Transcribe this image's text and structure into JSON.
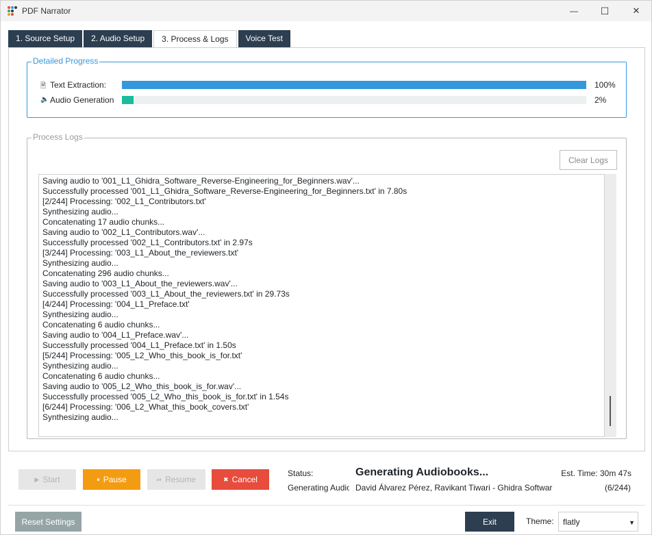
{
  "window": {
    "title": "PDF Narrator",
    "controls": {
      "minimize": "—",
      "maximize": "☐",
      "close": "✕"
    }
  },
  "tabs": [
    {
      "label": "1. Source Setup",
      "active": false
    },
    {
      "label": "2. Audio Setup",
      "active": false
    },
    {
      "label": "3. Process & Logs",
      "active": true
    },
    {
      "label": "Voice Test",
      "active": false
    }
  ],
  "progress": {
    "frame_title": "Detailed Progress",
    "rows": [
      {
        "icon": "document-icon",
        "label": "Text Extraction:",
        "percent_text": "100%",
        "value": 1.0,
        "color": "#3498db"
      },
      {
        "icon": "speaker-icon",
        "label": "Audio Generation",
        "percent_text": "2%",
        "value": 0.025,
        "color": "#1abc9c"
      }
    ]
  },
  "logs": {
    "frame_title": "Process Logs",
    "clear_label": "Clear Logs",
    "lines": [
      "Saving audio to '001_L1_Ghidra_Software_Reverse-Engineering_for_Beginners.wav'...",
      "Successfully processed '001_L1_Ghidra_Software_Reverse-Engineering_for_Beginners.txt' in 7.80s",
      "[2/244] Processing: '002_L1_Contributors.txt'",
      "Synthesizing audio...",
      "Concatenating 17 audio chunks...",
      "Saving audio to '002_L1_Contributors.wav'...",
      "Successfully processed '002_L1_Contributors.txt' in 2.97s",
      "[3/244] Processing: '003_L1_About_the_reviewers.txt'",
      "Synthesizing audio...",
      "Concatenating 296 audio chunks...",
      "Saving audio to '003_L1_About_the_reviewers.wav'...",
      "Successfully processed '003_L1_About_the_reviewers.txt' in 29.73s",
      "[4/244] Processing: '004_L1_Preface.txt'",
      "Synthesizing audio...",
      "Concatenating 6 audio chunks...",
      "Saving audio to '004_L1_Preface.wav'...",
      "Successfully processed '004_L1_Preface.txt' in 1.50s",
      "[5/244] Processing: '005_L2_Who_this_book_is_for.txt'",
      "Synthesizing audio...",
      "Concatenating 6 audio chunks...",
      "Saving audio to '005_L2_Who_this_book_is_for.wav'...",
      "Successfully processed '005_L2_Who_this_book_is_for.txt' in 1.54s",
      "[6/244] Processing: '006_L2_What_this_book_covers.txt'",
      "Synthesizing audio..."
    ]
  },
  "controls": {
    "start": {
      "icon": "play-icon",
      "glyph": "▶",
      "label": "Start",
      "enabled": false
    },
    "pause": {
      "icon": "pause-icon",
      "glyph": "⏸",
      "label": "Pause",
      "enabled": true,
      "color": "#f39c12"
    },
    "resume": {
      "icon": "resume-icon",
      "glyph": "⏯",
      "label": "Resume",
      "enabled": false
    },
    "cancel": {
      "icon": "cancel-icon",
      "glyph": "✖",
      "label": "Cancel",
      "enabled": true,
      "color": "#e74c3c"
    }
  },
  "status": {
    "label": "Status:",
    "title": "Generating Audiobooks...",
    "est_time": "Est. Time: 30m 47s",
    "sub": "Generating Audio",
    "book": "David Álvarez Pérez, Ravikant Tiwari - Ghidra Software R",
    "count": "(6/244)"
  },
  "footer": {
    "reset_label": "Reset Settings",
    "exit_label": "Exit",
    "theme_label": "Theme:",
    "theme_value": "flatly"
  }
}
